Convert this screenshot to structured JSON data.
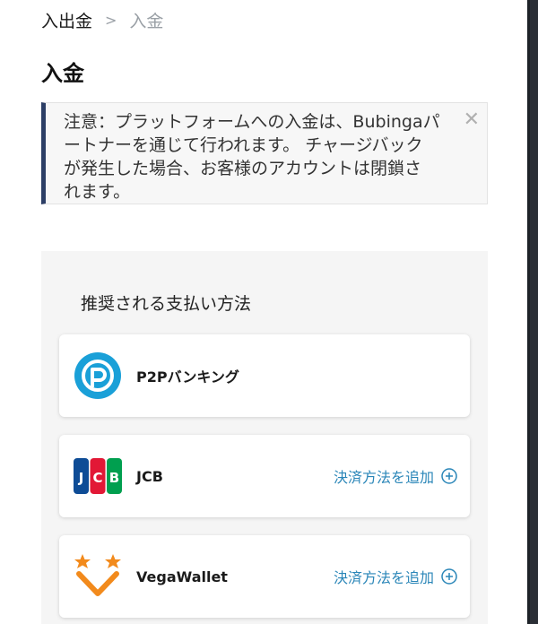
{
  "breadcrumb": {
    "home": "入出金",
    "separator": ">",
    "current": "入金"
  },
  "page_title": "入金",
  "notice": {
    "line1": "注意：プラットフォームへの入金は、Bubingaパ",
    "line2": "ートナーを通じて行われます。 チャージバック",
    "line3": "が発生した場合、お客様のアカウントは閉鎖さ",
    "line4": "れます。",
    "close_icon": "close-icon"
  },
  "payment": {
    "heading": "推奨される支払い方法",
    "methods": [
      {
        "name": "P2Pバンキング",
        "logo": "p2p-logo",
        "action": ""
      },
      {
        "name": "JCB",
        "logo": "jcb-logo",
        "action": "決済方法を追加"
      },
      {
        "name": "VegaWallet",
        "logo": "vegawallet-logo",
        "action": "決済方法を追加"
      }
    ]
  },
  "colors": {
    "accent": "#2a86b8",
    "notice_border": "#2c3e66",
    "p2p_blue": "#1aa0d8",
    "vega_orange": "#f28a1c"
  }
}
